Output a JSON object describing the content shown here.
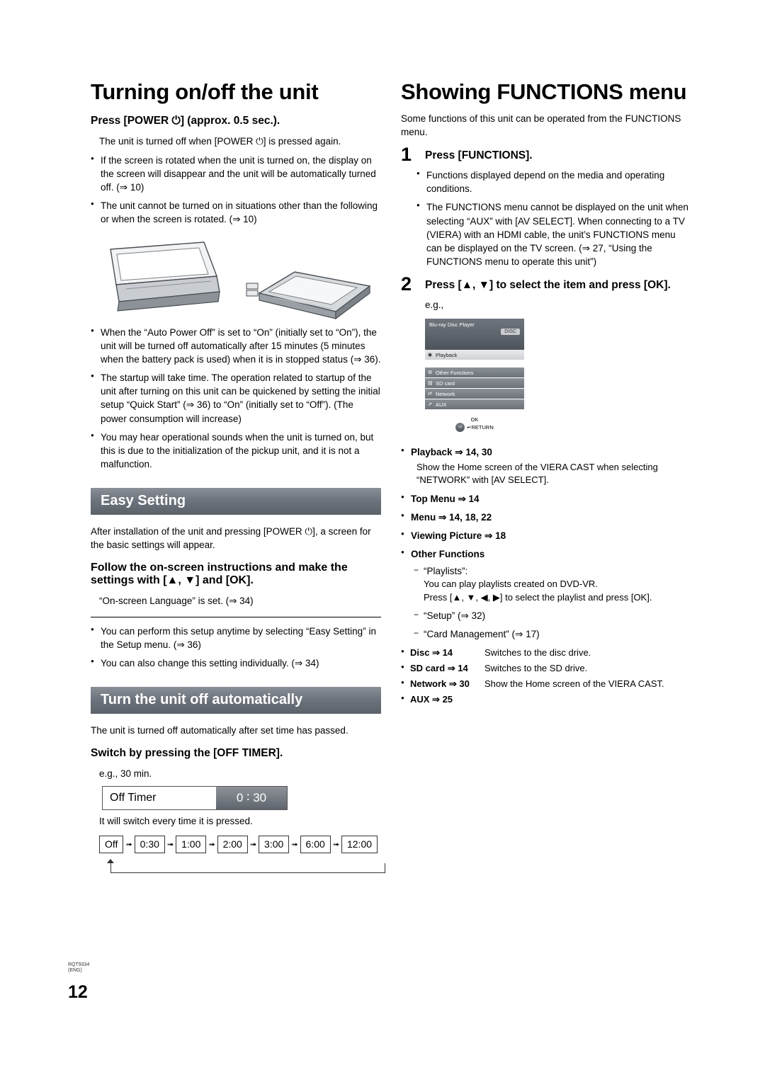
{
  "page": {
    "number": "12",
    "code_line1": "RQT9334",
    "code_line2": "(ENG)"
  },
  "left": {
    "title": "Turning on/off the unit",
    "press_power": "Press [POWER ⏻] (approx. 0.5 sec.).",
    "power_note": "The unit is turned off when [POWER ⏻] is pressed again.",
    "bullets": [
      "If the screen is rotated when the unit is turned on, the display on the screen will disappear and the unit will be automatically turned off. (⇒ 10)",
      "The unit cannot be turned on in situations other than the following or when the screen is rotated. (⇒ 10)"
    ],
    "bullets2": [
      "When the “Auto Power Off” is set to “On” (initially set to “On”), the unit will be turned off automatically after 15 minutes (5 minutes when the battery pack is used) when it is in stopped status (⇒ 36).",
      "The startup will take time. The operation related to startup of the unit after turning on this unit can be quickened by setting the initial setup “Quick Start” (⇒ 36) to “On” (initially set to “Off”). (The power consumption will increase)",
      "You may hear operational sounds when the unit is turned on, but this is due to the initialization of the pickup unit, and it is not a malfunction."
    ],
    "easy_setting": {
      "heading": "Easy Setting",
      "intro": "After installation of the unit and pressing [POWER ⏻], a screen for the basic settings will appear.",
      "step": "Follow the on-screen instructions and make the settings with [▲, ▼] and [OK].",
      "step_note": "“On-screen Language” is set. (⇒ 34)",
      "bullets": [
        "You can perform this setup anytime by selecting “Easy Setting” in the Setup menu. (⇒ 36)",
        "You can also change this setting individually. (⇒ 34)"
      ]
    },
    "auto_off": {
      "heading": "Turn the unit off automatically",
      "intro": "The unit is turned off automatically after set time has passed.",
      "step": "Switch by pressing the [OFF TIMER].",
      "eg": "e.g., 30 min.",
      "widget_label": "Off Timer",
      "widget_value": "0 ∶ 30",
      "note": "It will switch every time it is pressed.",
      "chain": [
        "Off",
        "0:30",
        "1:00",
        "2:00",
        "3:00",
        "6:00",
        "12:00"
      ]
    }
  },
  "right": {
    "title": "Showing FUNCTIONS menu",
    "intro": "Some functions of this unit can be operated from the FUNCTIONS menu.",
    "step1": {
      "num": "1",
      "label": "Press [FUNCTIONS]."
    },
    "step1_bullets": [
      "Functions displayed depend on the media and operating conditions.",
      "The FUNCTIONS menu cannot be displayed on the unit when selecting “AUX” with [AV SELECT]. When connecting to a TV (VIERA) with an HDMI cable, the unit’s FUNCTIONS menu can be displayed on the TV screen. (⇒ 27, “Using the FUNCTIONS menu to operate this unit”)"
    ],
    "step2": {
      "num": "2",
      "label": "Press [▲, ▼] to select the item and press [OK]."
    },
    "eg": "e.g.,",
    "mock": {
      "title": "Blu-ray Disc Player",
      "disc_badge": "DISC",
      "rows": [
        {
          "icon": "◉",
          "label": "Playback",
          "selected": true
        },
        {
          "icon": "⚙",
          "label": "Other Functions",
          "selected": false
        },
        {
          "icon": "▤",
          "label": "SD card",
          "selected": false
        },
        {
          "icon": "⇄",
          "label": "Network",
          "selected": false
        },
        {
          "icon": "↗",
          "label": "AUX",
          "selected": false
        }
      ],
      "ok_label": "OK",
      "return_label": "↵RETURN"
    },
    "items": [
      {
        "key": "Playback ⇒ 14, 30",
        "note": "Show the Home screen of the VIERA CAST when selecting “NETWORK” with [AV SELECT]."
      },
      {
        "key": "Top Menu ⇒ 14",
        "note": ""
      },
      {
        "key": "Menu ⇒ 14, 18, 22",
        "note": ""
      },
      {
        "key": "Viewing Picture ⇒ 18",
        "note": ""
      },
      {
        "key": "Other Functions",
        "note": ""
      }
    ],
    "other_functions": [
      {
        "dash": "“Playlists”:",
        "lines": [
          "You can play playlists created on DVD-VR.",
          "Press [▲, ▼, ◀, ▶] to select the playlist and press [OK]."
        ]
      },
      {
        "dash": "“Setup” (⇒ 32)",
        "lines": []
      },
      {
        "dash": "“Card Management” (⇒ 17)",
        "lines": []
      }
    ],
    "deflist": [
      {
        "k": "Disc ⇒ 14",
        "v": "Switches to the disc drive."
      },
      {
        "k": "SD card ⇒ 14",
        "v": "Switches to the SD drive."
      },
      {
        "k": "Network ⇒ 30",
        "v": "Show the Home screen of the VIERA CAST."
      },
      {
        "k": "AUX ⇒ 25",
        "v": ""
      }
    ]
  },
  "colors": {
    "heading_bg": "#6e747d",
    "text": "#000000",
    "mock_panel": "#7b8189"
  }
}
